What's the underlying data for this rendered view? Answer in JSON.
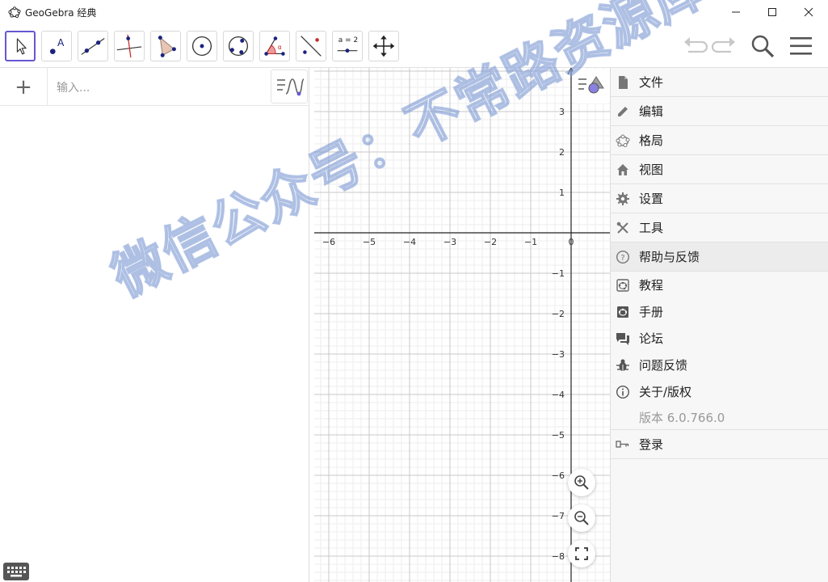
{
  "window": {
    "title": "GeoGebra 经典",
    "accent": "#6557d2"
  },
  "toolbar": {
    "tools": [
      {
        "name": "move-tool-icon"
      },
      {
        "name": "point-tool-icon"
      },
      {
        "name": "line-tool-icon"
      },
      {
        "name": "perpendicular-line-tool-icon"
      },
      {
        "name": "polygon-tool-icon"
      },
      {
        "name": "circle-center-point-tool-icon"
      },
      {
        "name": "circle-three-points-tool-icon"
      },
      {
        "name": "angle-tool-icon"
      },
      {
        "name": "reflect-tool-icon"
      },
      {
        "name": "slider-tool-icon",
        "label": "a = 2"
      },
      {
        "name": "move-graphics-view-tool-icon"
      }
    ],
    "right_icons": [
      "undo-icon",
      "redo-icon",
      "search-icon",
      "menu-icon"
    ]
  },
  "algebra": {
    "plus": "+",
    "input_placeholder": "输入..."
  },
  "graphics": {
    "x_ticks": [
      "−6",
      "−5",
      "−4",
      "−3",
      "−2",
      "−1",
      "0"
    ],
    "y_ticks_pos": [
      "3",
      "2",
      "1"
    ],
    "y_ticks_neg": [
      "−1",
      "−2",
      "−3",
      "−4",
      "−5",
      "−6",
      "−7",
      "−8"
    ]
  },
  "menu": {
    "items": [
      {
        "label": "文件",
        "icon": "file-icon"
      },
      {
        "label": "编辑",
        "icon": "pencil-icon"
      },
      {
        "label": "格局",
        "icon": "layout-icon"
      },
      {
        "label": "视图",
        "icon": "home-icon"
      },
      {
        "label": "设置",
        "icon": "gear-icon"
      },
      {
        "label": "工具",
        "icon": "tools-icon"
      },
      {
        "label": "帮助与反馈",
        "icon": "help-icon"
      },
      {
        "label": "教程",
        "icon": "tutorial-icon"
      },
      {
        "label": "手册",
        "icon": "manual-icon"
      },
      {
        "label": "论坛",
        "icon": "forum-icon"
      },
      {
        "label": "问题反馈",
        "icon": "bug-icon"
      },
      {
        "label": "关于/版权",
        "icon": "info-icon"
      },
      {
        "label": "版本 6.0.766.0"
      },
      {
        "label": "登录",
        "icon": "login-icon"
      }
    ]
  },
  "watermark": "微信公众号：不常路资源库"
}
